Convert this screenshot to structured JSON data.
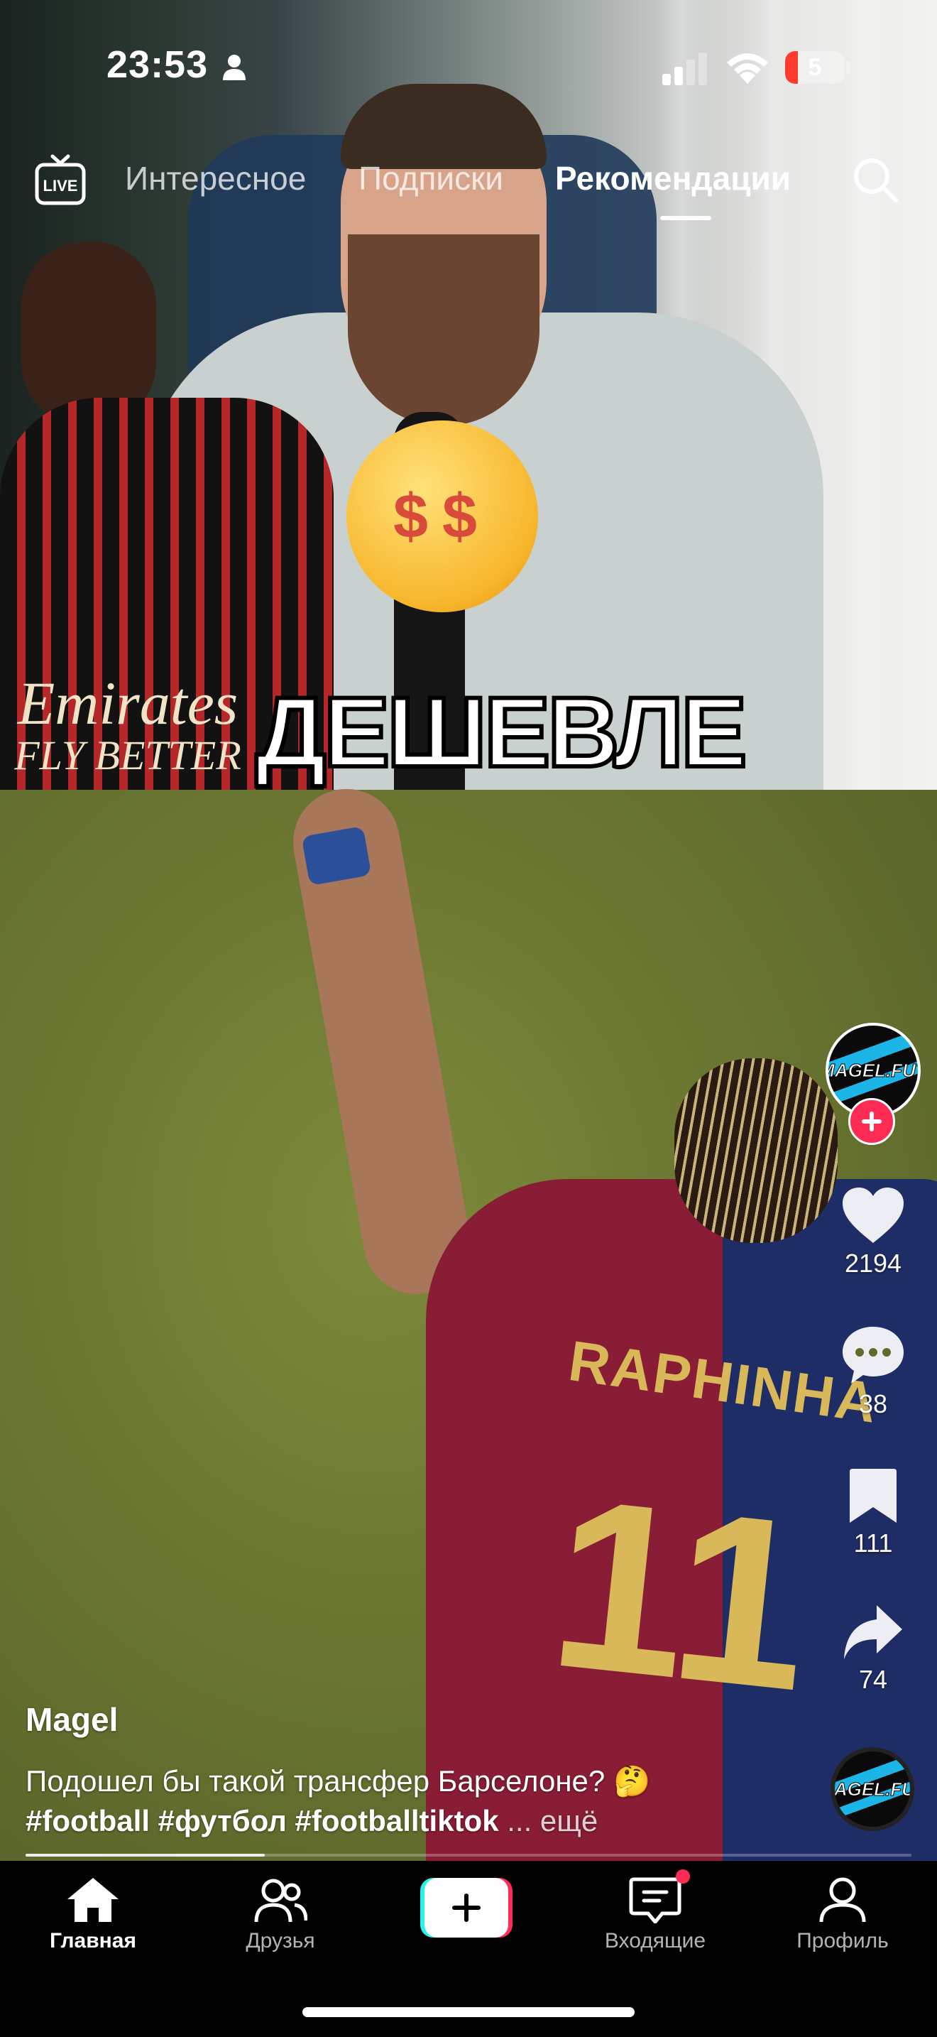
{
  "status_bar": {
    "time": "23:53",
    "battery": "5",
    "icons": [
      "person-icon",
      "signal-icon",
      "wifi-icon",
      "battery-icon"
    ]
  },
  "top_nav": {
    "live_icon": "live-icon",
    "tabs": [
      {
        "label": "Интересное",
        "active": false
      },
      {
        "label": "Подписки",
        "active": false
      },
      {
        "label": "Рекомендации",
        "active": true
      }
    ],
    "search_icon": "search-icon"
  },
  "video": {
    "overlay_caption": "ДЕШЕВЛЕ",
    "sponsor_line1": "Emirates",
    "sponsor_line2": "FLY BETTER",
    "jersey_name": "RAPHINHA",
    "jersey_number": "11",
    "progress": 0.27
  },
  "post": {
    "avatar_text": "MAGEL.FUT",
    "author": "Magel",
    "description": "Подошел бы такой трансфер Барселоне? 🤔",
    "hashtags": "#football #футбол #footballtiktok",
    "more_label": "... ещё"
  },
  "actions": {
    "likes": "2194",
    "comments": "38",
    "saves": "111",
    "shares": "74"
  },
  "bottom_nav": {
    "home": "Главная",
    "friends": "Друзья",
    "inbox": "Входящие",
    "profile": "Профиль"
  },
  "colors": {
    "accent": "#fe2c55",
    "cyan": "#25f4ee",
    "background": "#000000"
  }
}
